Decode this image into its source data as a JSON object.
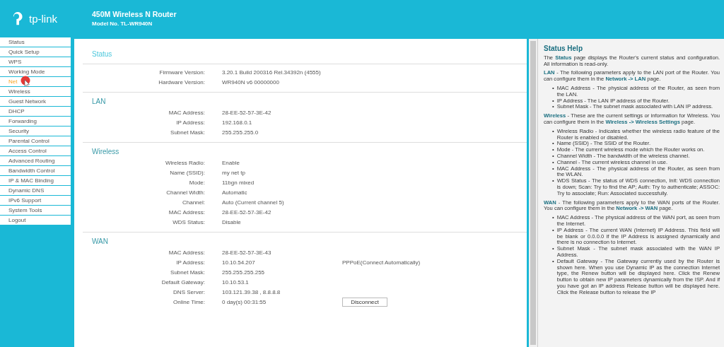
{
  "header": {
    "logo": "tp-link",
    "title": "450M Wireless N Router",
    "model": "Model No. TL-WR940N"
  },
  "sidebar": {
    "items": [
      {
        "label": "Status",
        "selected": false
      },
      {
        "label": "Quick Setup",
        "selected": false
      },
      {
        "label": "WPS",
        "selected": false
      },
      {
        "label": "Working Mode",
        "selected": false
      },
      {
        "label": "Net",
        "selected": true
      },
      {
        "label": "Wireless",
        "selected": false
      },
      {
        "label": "Guest Network",
        "selected": false
      },
      {
        "label": "DHCP",
        "selected": false
      },
      {
        "label": "Forwarding",
        "selected": false
      },
      {
        "label": "Security",
        "selected": false
      },
      {
        "label": "Parental Control",
        "selected": false
      },
      {
        "label": "Access Control",
        "selected": false
      },
      {
        "label": "Advanced Routing",
        "selected": false
      },
      {
        "label": "Bandwidth Control",
        "selected": false
      },
      {
        "label": "IP & MAC Binding",
        "selected": false
      },
      {
        "label": "Dynamic DNS",
        "selected": false
      },
      {
        "label": "IPv6 Support",
        "selected": false
      },
      {
        "label": "System Tools",
        "selected": false
      },
      {
        "label": "Logout",
        "selected": false
      }
    ]
  },
  "sections": [
    {
      "kind": "page-title",
      "title": "Status",
      "rows": [
        {
          "label": "Firmware Version:",
          "value": "3.20.1 Build 200316 Rel.34392n (4555)"
        },
        {
          "label": "Hardware Version:",
          "value": "WR940N v6 00000000"
        }
      ]
    },
    {
      "kind": "section",
      "title": "LAN",
      "rows": [
        {
          "label": "MAC Address:",
          "value": "28-EE-52-57-3E-42"
        },
        {
          "label": "IP Address:",
          "value": "192.168.0.1"
        },
        {
          "label": "Subnet Mask:",
          "value": "255.255.255.0"
        }
      ]
    },
    {
      "kind": "section",
      "title": "Wireless",
      "rows": [
        {
          "label": "Wireless Radio:",
          "value": "Enable"
        },
        {
          "label": "Name (SSID):",
          "value": "my net tp"
        },
        {
          "label": "Mode:",
          "value": "11bgn mixed"
        },
        {
          "label": "Channel Width:",
          "value": "Automatic"
        },
        {
          "label": "Channel:",
          "value": "Auto (Current channel 5)"
        },
        {
          "label": "MAC Address:",
          "value": "28-EE-52-57-3E-42"
        },
        {
          "label": "WDS Status:",
          "value": "Disable"
        }
      ]
    },
    {
      "kind": "section",
      "title": "WAN",
      "rows": [
        {
          "label": "MAC Address:",
          "value": "28-EE-52-57-3E-43"
        },
        {
          "label": "IP Address:",
          "value": "10.10.54.207",
          "note": "PPPoE(Connect Automatically)"
        },
        {
          "label": "Subnet Mask:",
          "value": "255.255.255.255"
        },
        {
          "label": "Default Gateway:",
          "value": "10.10.53.1"
        },
        {
          "label": "DNS Server:",
          "value": "103.121.39.38 , 8.8.8.8"
        },
        {
          "label": "Online Time:",
          "value": "0 day(s) 00:31:55",
          "button": "Disconnect"
        }
      ]
    }
  ],
  "help": {
    "title": "Status Help",
    "blocks": [
      {
        "kind": "paragraph",
        "text": "The **Status** page displays the Router's current status and configuration. All information is read-only."
      },
      {
        "kind": "paragraph",
        "text": "**LAN** - The following parameters apply to the LAN port of the Router. You can configure them in the **Network -> LAN** page."
      },
      {
        "kind": "list",
        "marker": "•",
        "items": [
          "MAC Address - The physical address of the Router, as seen from the LAN.",
          "IP Address - The LAN IP address of the Router.",
          "Subnet Mask - The subnet mask associated with LAN IP address."
        ]
      },
      {
        "kind": "paragraph",
        "text": "**Wireless** - These are the current settings or information for Wireless. You can configure them in the **Wireless -> Wireless Settings** page."
      },
      {
        "kind": "list",
        "marker": "•",
        "items": [
          "Wireless Radio - Indicates whether the wireless radio feature of the Router is enabled or disabled.",
          "Name (SSID) - The SSID of the Router.",
          "Mode - The current wireless mode which the Router works on.",
          "Channel Width - The bandwidth of the wireless channel.",
          "Channel - The current wireless channel in use.",
          "MAC Address - The physical address of the Router, as seen from the WLAN.",
          "WDS Status - The status of WDS connection, Init: WDS connection is down; Scan: Try to find the AP; Auth: Try to authenticate; ASSOC: Try to associate; Run: Associated successfully."
        ]
      },
      {
        "kind": "paragraph",
        "text": "**WAN** - The following parameters apply to the WAN ports of the Router. You can configure them in the **Network -> WAN** page."
      },
      {
        "kind": "list",
        "marker": "•",
        "items": [
          "MAC Address - The physical address of the WAN port, as seen from the Internet.",
          "IP Address - The current WAN (Internet) IP Address. This field will be blank or 0.0.0.0 if the IP Address is assigned dynamically and there is no connection to Internet.",
          "Subnet Mask - The subnet mask associated with the WAN IP Address.",
          "Default Gateway - The Gateway currently used by the Router is shown here. When you use Dynamic IP as the connection Internet type, the Renew button will be displayed here. Click the Renew button to obtain new IP parameters dynamically from the ISP. And if you have got an IP address Release button will be displayed here. Click the Release button to release the IP"
        ]
      }
    ]
  }
}
